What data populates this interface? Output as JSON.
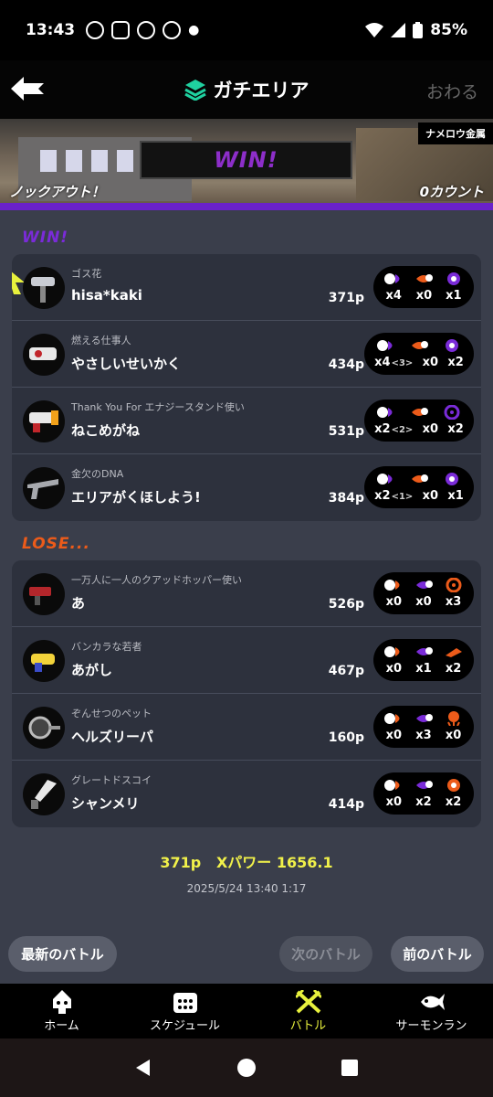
{
  "status": {
    "time": "13:43",
    "battery": "85%"
  },
  "header": {
    "title": "ガチエリア",
    "close_label": "おわる"
  },
  "banner": {
    "result": "WIN!",
    "stage": "ナメロウ金属",
    "knockout": "ノックアウト！",
    "count": "0カウント"
  },
  "win_label": "WIN!",
  "lose_label": "LOSE...",
  "win_team": [
    {
      "title": "ゴス花",
      "name": "hisa*kaki",
      "points": "371p",
      "kills": "x4",
      "assists": "",
      "specials_used": "x0",
      "special": "x1"
    },
    {
      "title": "燃える仕事人",
      "name": "やさしいせいかく",
      "points": "434p",
      "kills": "x4",
      "assists": "<3>",
      "specials_used": "x0",
      "special": "x2"
    },
    {
      "title": "Thank You For エナジースタンド使い",
      "name": "ねこめがね",
      "points": "531p",
      "kills": "x2",
      "assists": "<2>",
      "specials_used": "x0",
      "special": "x2"
    },
    {
      "title": "金欠のDNA",
      "name": "エリアがくほしよう!",
      "points": "384p",
      "kills": "x2",
      "assists": "<1>",
      "specials_used": "x0",
      "special": "x1"
    }
  ],
  "lose_team": [
    {
      "title": "一万人に一人のクアッドホッパー使い",
      "name": "あ",
      "points": "526p",
      "kills": "x0",
      "deaths": "x0",
      "special": "x3"
    },
    {
      "title": "バンカラな若者",
      "name": "あがし",
      "points": "467p",
      "kills": "x0",
      "deaths": "x1",
      "special": "x2"
    },
    {
      "title": "ぞんせつのペット",
      "name": "ヘルズリーパ",
      "points": "160p",
      "kills": "x0",
      "deaths": "x3",
      "special": "x0"
    },
    {
      "title": "グレートドスコイ",
      "name": "シャンメリ",
      "points": "414p",
      "kills": "x0",
      "deaths": "x2",
      "special": "x2"
    }
  ],
  "summary": {
    "points": "371p",
    "xpower": "Xパワー 1656.1"
  },
  "datetime": "2025/5/24 13:40 1:17",
  "nav": {
    "latest": "最新のバトル",
    "next": "次のバトル",
    "prev": "前のバトル"
  },
  "tabs": [
    {
      "label": "ホーム"
    },
    {
      "label": "スケジュール"
    },
    {
      "label": "バトル"
    },
    {
      "label": "サーモンラン"
    }
  ],
  "colors": {
    "win": "#7a2bd8",
    "lose": "#ec5b1a",
    "highlight": "#e8f13d"
  }
}
